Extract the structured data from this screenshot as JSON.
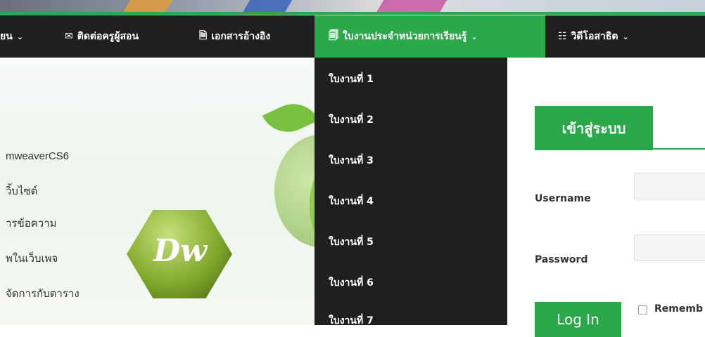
{
  "nav": {
    "item0_label": "ยน",
    "item1_label": "ติดต่อครูผู้สอน",
    "item2_label": "เอกสารอ้างอิง",
    "item3_label": "ใบงานประจำหน่วยการเรียนรู้",
    "item4_label": "วิดีโอสาธิต",
    "accent_color": "#2aa84a"
  },
  "hero": {
    "lines": [
      "mweaverCS6",
      "วิ้บไซต์",
      "ารข้อความ",
      "พในเว็บเพจ",
      "จัดการกับตาราง"
    ],
    "logo_text": "Dw"
  },
  "dropdown": {
    "items": [
      "ใบงานที่ 1",
      "ใบงานที่ 2",
      "ใบงานที่ 3",
      "ใบงานที่ 4",
      "ใบงานที่ 5",
      "ใบงานที่ 6",
      "ใบงานที่ 7"
    ]
  },
  "login": {
    "tab_label": "เข้าสู่ระบบ",
    "username_label": "Username",
    "password_label": "Password",
    "button_label": "Log In",
    "remember_label": "Rememb"
  }
}
